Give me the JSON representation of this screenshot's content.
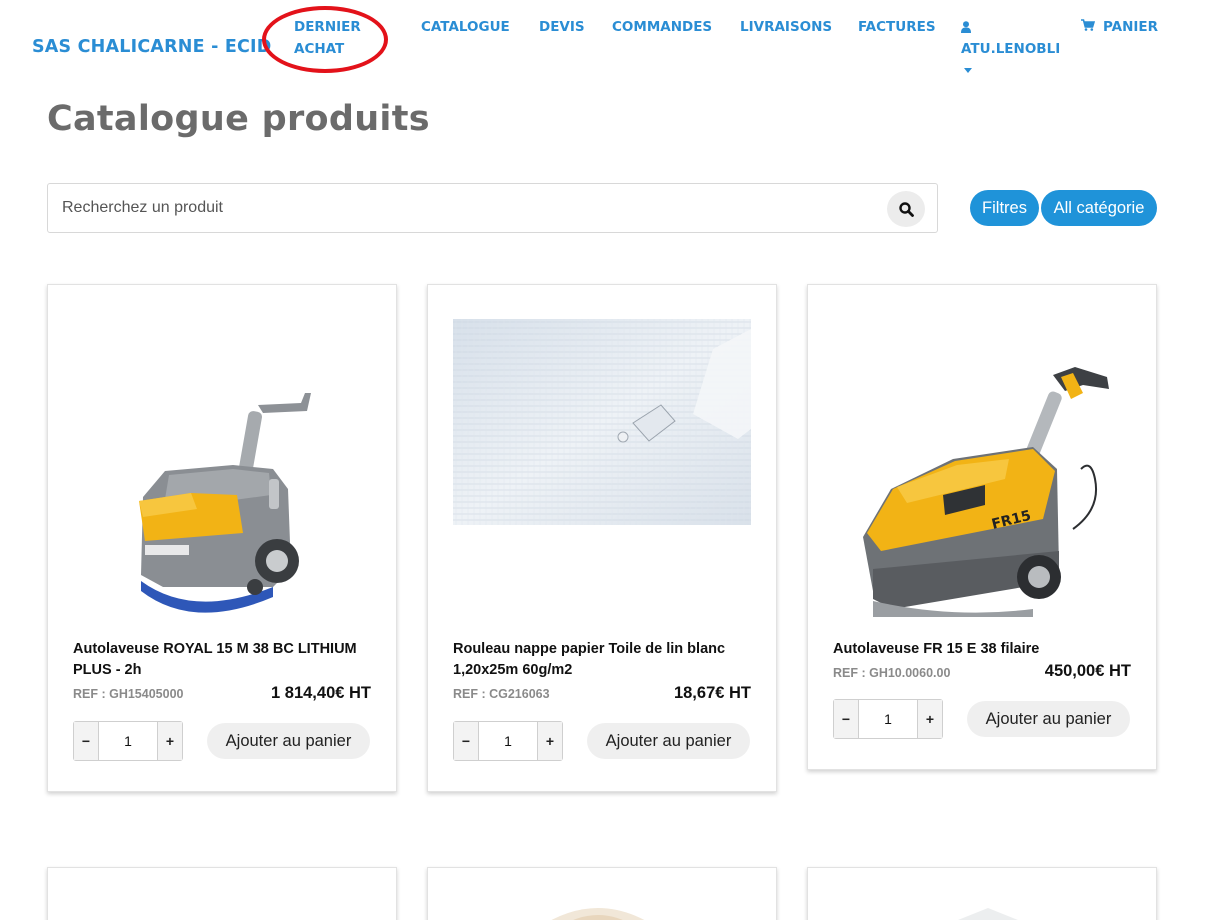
{
  "brand": "SAS CHALICARNE - ECID",
  "nav": {
    "dernier_achat_line1": "DERNIER",
    "dernier_achat_line2": "ACHAT",
    "catalogue": "CATALOGUE",
    "devis": "DEVIS",
    "commandes": "COMMANDES",
    "livraisons": "LIVRAISONS",
    "factures": "FACTURES",
    "user": "ATU.LENOBLI",
    "panier": "PANIER"
  },
  "colors": {
    "accent": "#2a8dd4",
    "pill": "#1f93d9",
    "highlight": "#e3121a",
    "title": "#6b6b6b"
  },
  "icons": {
    "user": "user-icon",
    "cart": "cart-icon",
    "search": "search-icon",
    "caret": "caret-down-icon"
  },
  "page_title": "Catalogue produits",
  "search": {
    "placeholder": "Recherchez un produit"
  },
  "filters": {
    "filtres": "Filtres",
    "category": "All catégorie"
  },
  "products": [
    {
      "name": "Autolaveuse ROYAL 15 M 38 BC LITHIUM PLUS - 2h",
      "ref": "REF : GH15405000",
      "price": "1 814,40€ HT",
      "qty": "1",
      "add_label": "Ajouter au panier",
      "image": "yellow-gray-floor-scrubber"
    },
    {
      "name": "Rouleau nappe papier Toile de lin blanc 1,20x25m 60g/m2",
      "ref": "REF : CG216063",
      "price": "18,67€ HT",
      "qty": "1",
      "add_label": "Ajouter au panier",
      "image": "white-linen-paper-tablecloth"
    },
    {
      "name": "Autolaveuse FR 15 E 38 filaire",
      "ref": "REF : GH10.0060.00",
      "price": "450,00€ HT",
      "qty": "1",
      "add_label": "Ajouter au panier",
      "image": "yellow-floor-scrubber-fr15",
      "machine_badge": "FR15"
    }
  ],
  "qty_controls": {
    "minus": "−",
    "plus": "+"
  }
}
